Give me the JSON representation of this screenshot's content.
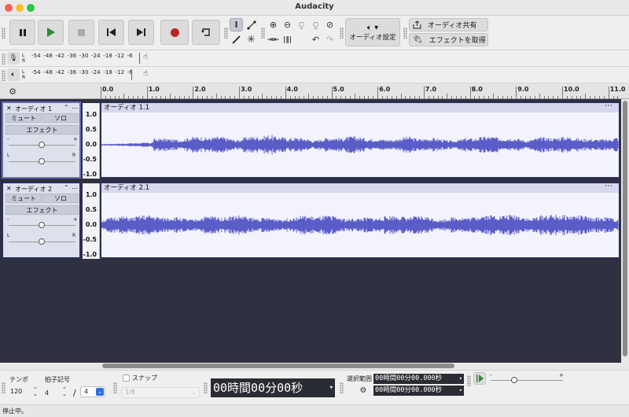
{
  "window": {
    "title": "Audacity",
    "colors": {
      "close": "#fe5f57",
      "minimize": "#febc2e",
      "maximize": "#28c840"
    }
  },
  "toolbar": {
    "audio_settings_label": "オーディオ設定",
    "share_audio_label": "オーディオ共有",
    "get_effects_label": "エフェクトを取得",
    "icons": [
      "pause-icon",
      "play-icon",
      "stop-icon",
      "skip-start-icon",
      "skip-end-icon",
      "record-icon",
      "loop-icon",
      "selection-tool-icon",
      "envelope-tool-icon",
      "draw-tool-icon",
      "multi-tool-icon",
      "zoom-in-icon",
      "zoom-out-icon",
      "fit-selection-icon",
      "fit-project-icon",
      "zoom-toggle-icon",
      "trim-icon",
      "silence-icon",
      "undo-icon",
      "redo-icon",
      "speaker-icon",
      "share-icon",
      "plugin-icon"
    ]
  },
  "meters": {
    "record": {
      "l": "L",
      "r": "R",
      "scale": [
        "-54",
        "-48",
        "-42",
        "-36",
        "-30",
        "-24",
        "-18",
        "-12",
        "-6"
      ]
    },
    "playback": {
      "l": "L",
      "r": "R",
      "scale": [
        "-54",
        "-48",
        "-42",
        "-36",
        "-30",
        "-24",
        "-18",
        "-12",
        "-6"
      ]
    }
  },
  "ruler": {
    "labels": [
      "0.0",
      "1.0",
      "2.0",
      "3.0",
      "4.0",
      "5.0",
      "6.0",
      "7.0",
      "8.0",
      "9.0",
      "10.0",
      "11.0"
    ]
  },
  "tracks": [
    {
      "name": "オーディオ 1",
      "mute": "ミュート",
      "solo": "ソロ",
      "effects": "エフェクト",
      "clip_name": "オーディオ 1.1",
      "scale": [
        "1.0",
        "0.5",
        "0.0",
        "-0.5",
        "-1.0"
      ],
      "gain_minus": "-",
      "gain_plus": "+",
      "pan_l": "L",
      "pan_r": "R",
      "selected": true
    },
    {
      "name": "オーディオ 2",
      "mute": "ミュート",
      "solo": "ソロ",
      "effects": "エフェクト",
      "clip_name": "オーディオ 2.1",
      "scale": [
        "1.0",
        "0.5",
        "0.0",
        "-0.5",
        "-1.0"
      ],
      "gain_minus": "-",
      "gain_plus": "+",
      "pan_l": "L",
      "pan_r": "R",
      "selected": false
    }
  ],
  "bottom": {
    "tempo_label": "テンポ",
    "tempo_value": "120",
    "time_sig_label": "拍子記号",
    "time_sig_upper": "4",
    "time_sig_slash": "/",
    "time_sig_lower": "4",
    "snap_label": "スナップ",
    "snap_value": "1/8",
    "time_display": "00時間00分00秒",
    "selection_label": "選択範囲",
    "selection_start": "00時間00分00.000秒",
    "selection_end": "00時間00分00.000秒",
    "speed_minus": "-",
    "speed_plus": "+"
  },
  "status": {
    "text": "停止中。"
  },
  "colors": {
    "waveform": "#5a5cc8",
    "clip_header": "#d6d8ef",
    "workspace": "#2d3140",
    "record": "#c02428",
    "play": "#2e8b3a"
  }
}
